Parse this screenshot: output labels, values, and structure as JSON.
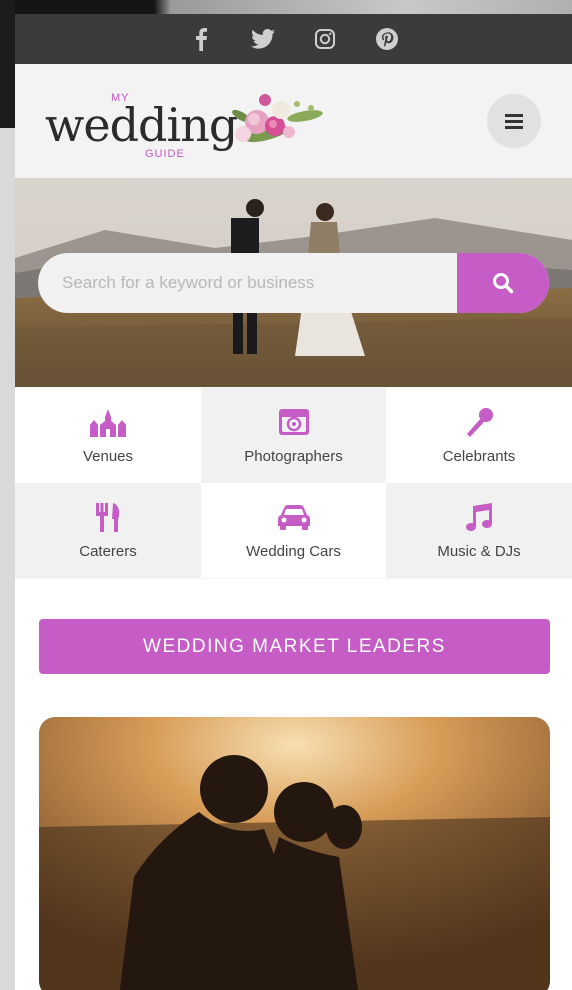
{
  "colors": {
    "accent": "#c65cc6",
    "social_bar": "#3b3b3b",
    "text": "#444444"
  },
  "social": [
    {
      "name": "facebook-icon"
    },
    {
      "name": "twitter-icon"
    },
    {
      "name": "instagram-icon"
    },
    {
      "name": "pinterest-icon"
    }
  ],
  "logo": {
    "my": "MY",
    "word": "wedding",
    "guide": "GUIDE"
  },
  "search": {
    "placeholder": "Search for a keyword or business"
  },
  "categories": [
    {
      "label": "Venues",
      "icon": "venue-icon"
    },
    {
      "label": "Photographers",
      "icon": "camera-icon"
    },
    {
      "label": "Celebrants",
      "icon": "microphone-icon"
    },
    {
      "label": "Caterers",
      "icon": "cutlery-icon"
    },
    {
      "label": "Wedding Cars",
      "icon": "car-icon"
    },
    {
      "label": "Music & DJs",
      "icon": "music-note-icon"
    }
  ],
  "leaders_button": "WEDDING MARKET LEADERS"
}
